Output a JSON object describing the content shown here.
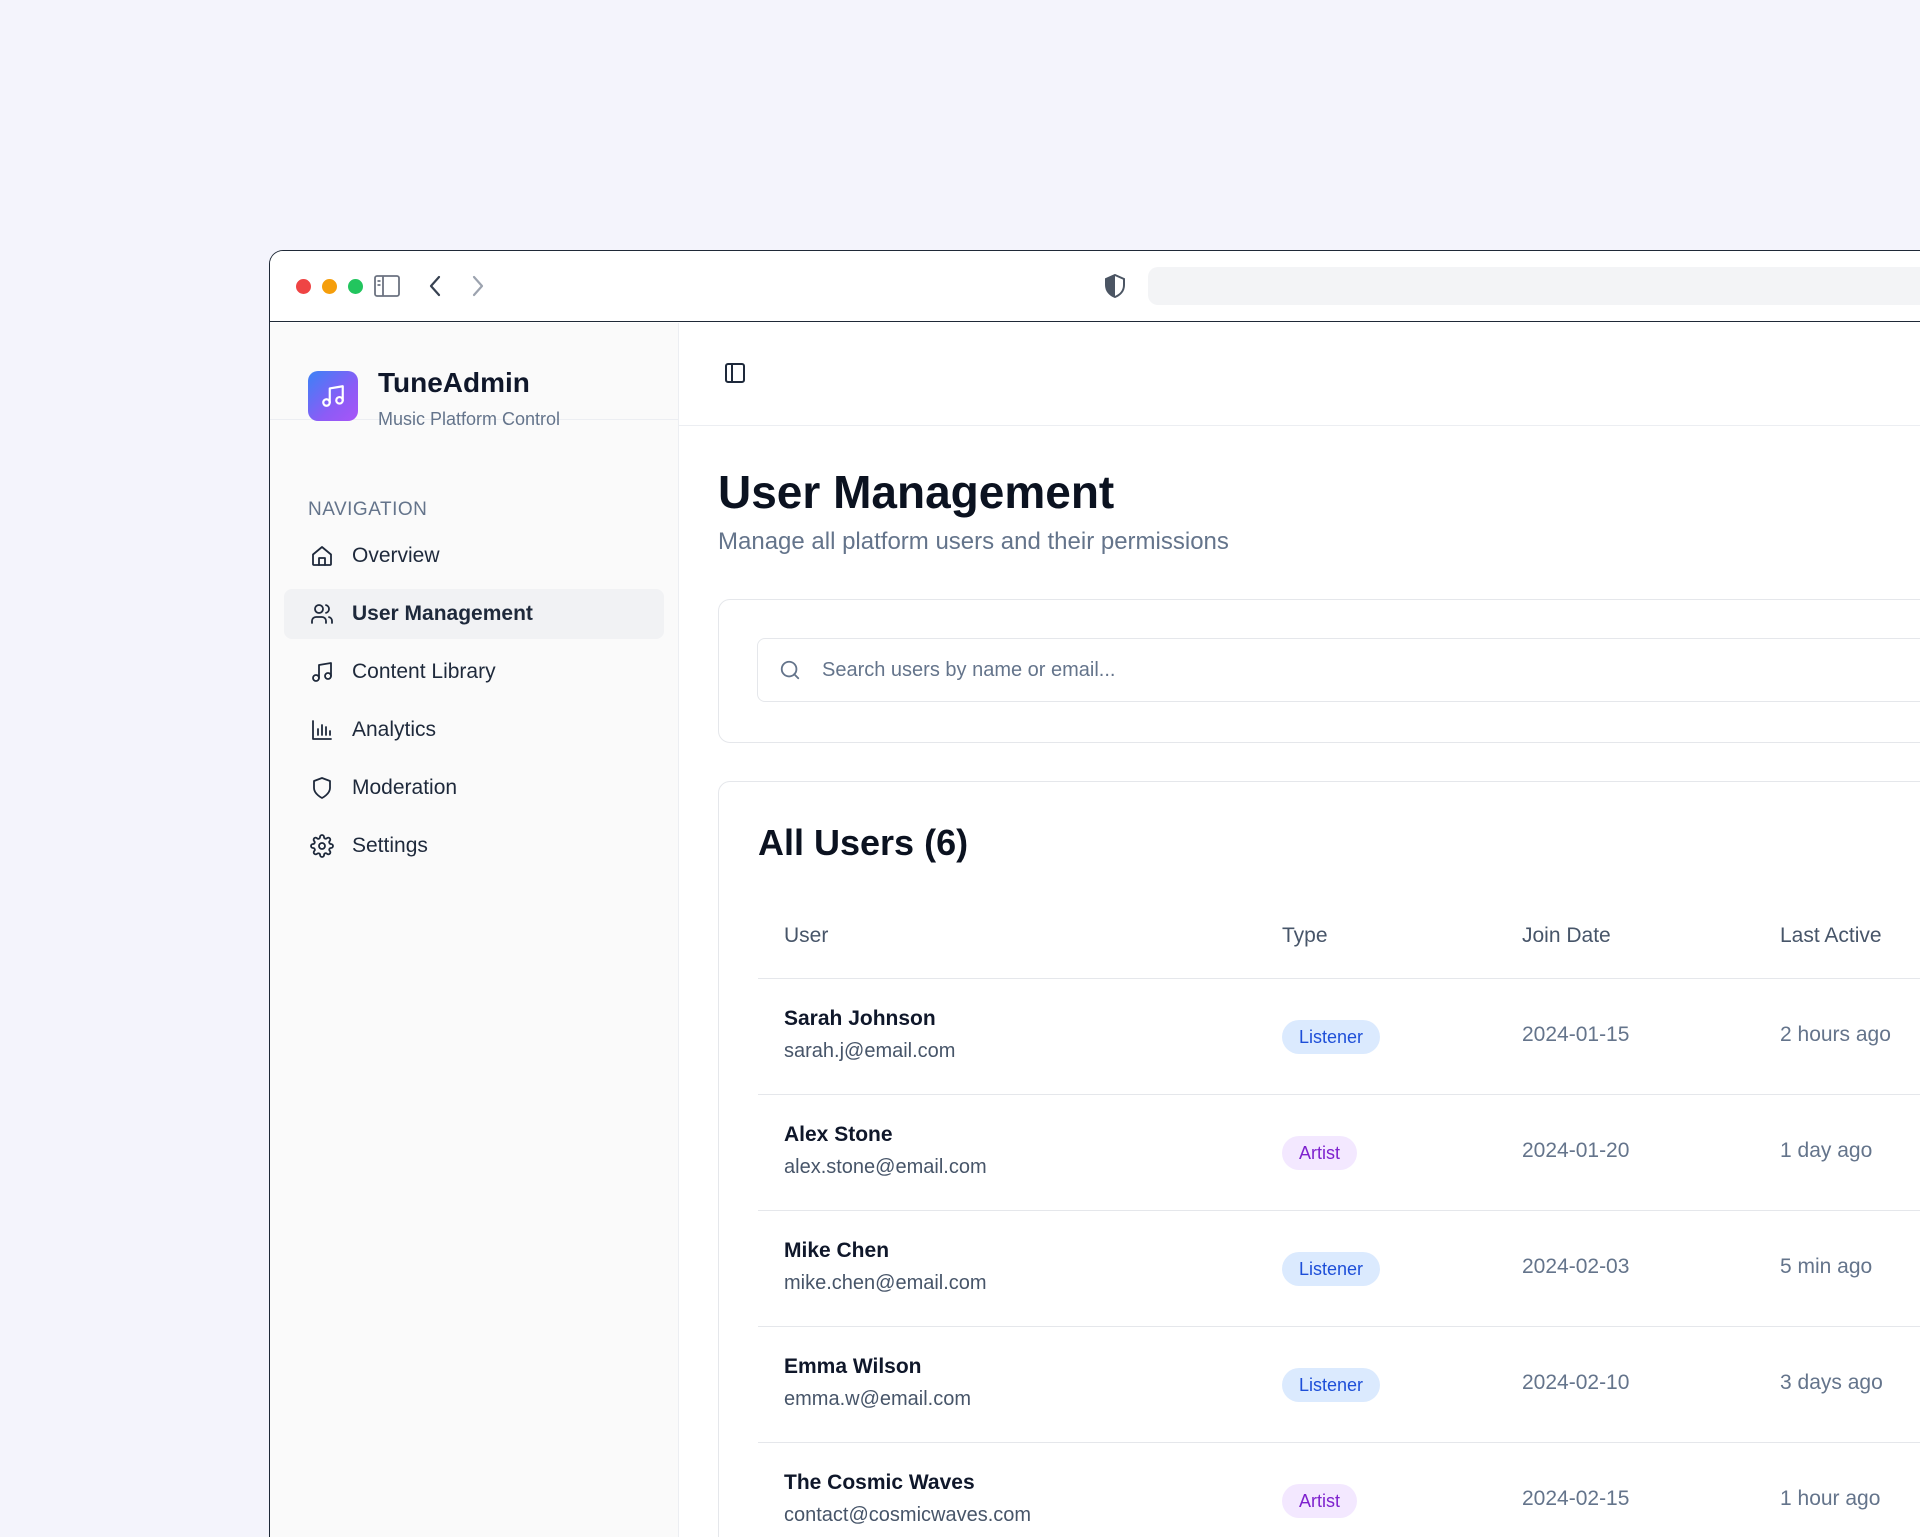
{
  "app": {
    "name": "TuneAdmin",
    "subtitle": "Music Platform Control"
  },
  "sidebar": {
    "heading": "NAVIGATION",
    "items": [
      {
        "label": "Overview",
        "icon": "home-icon",
        "active": false
      },
      {
        "label": "User Management",
        "icon": "users-icon",
        "active": true
      },
      {
        "label": "Content Library",
        "icon": "music-note-icon",
        "active": false
      },
      {
        "label": "Analytics",
        "icon": "bar-chart-icon",
        "active": false
      },
      {
        "label": "Moderation",
        "icon": "shield-icon",
        "active": false
      },
      {
        "label": "Settings",
        "icon": "gear-icon",
        "active": false
      }
    ]
  },
  "page": {
    "title": "User Management",
    "subtitle": "Manage all platform users and their permissions"
  },
  "search": {
    "placeholder": "Search users by name or email...",
    "value": ""
  },
  "users": {
    "title": "All Users (6)",
    "columns": [
      "User",
      "Type",
      "Join Date",
      "Last Active"
    ],
    "rows": [
      {
        "name": "Sarah Johnson",
        "email": "sarah.j@email.com",
        "type": "Listener",
        "join_date": "2024-01-15",
        "last_active": "2 hours ago"
      },
      {
        "name": "Alex Stone",
        "email": "alex.stone@email.com",
        "type": "Artist",
        "join_date": "2024-01-20",
        "last_active": "1 day ago"
      },
      {
        "name": "Mike Chen",
        "email": "mike.chen@email.com",
        "type": "Listener",
        "join_date": "2024-02-03",
        "last_active": "5 min ago"
      },
      {
        "name": "Emma Wilson",
        "email": "emma.w@email.com",
        "type": "Listener",
        "join_date": "2024-02-10",
        "last_active": "3 days ago"
      },
      {
        "name": "The Cosmic Waves",
        "email": "contact@cosmicwaves.com",
        "type": "Artist",
        "join_date": "2024-02-15",
        "last_active": "1 hour ago"
      }
    ]
  },
  "colors": {
    "listener_badge_bg": "#dbeafe",
    "listener_badge_text": "#1d4ed8",
    "artist_badge_bg": "#f3e8ff",
    "artist_badge_text": "#7e22ce",
    "logo_gradient_start": "#3b82f6",
    "logo_gradient_end": "#a855f7"
  }
}
